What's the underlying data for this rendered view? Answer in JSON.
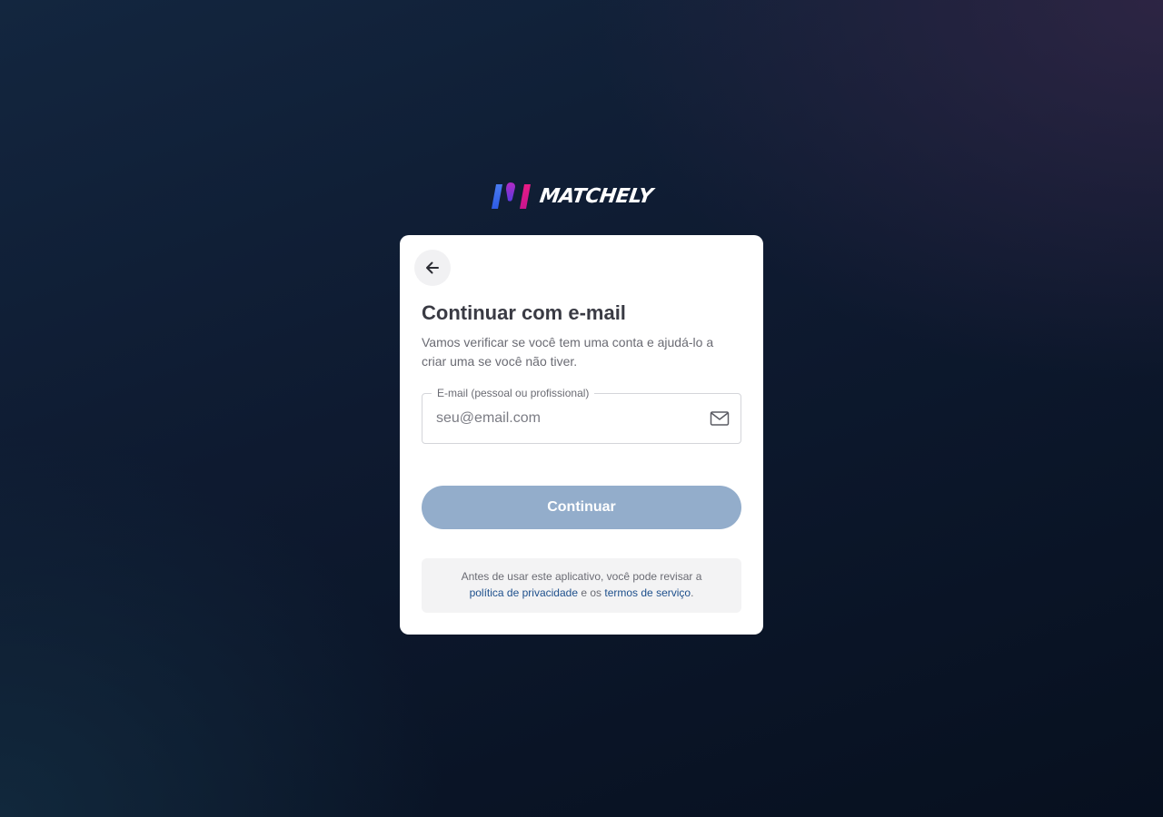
{
  "brand": {
    "name": "MATCHELY",
    "colors": {
      "mark_blue": "#2d5be6",
      "mark_purple": "#8a2fd6",
      "mark_pink": "#e0198a"
    }
  },
  "card": {
    "back_icon": "arrow-left-icon",
    "title": "Continuar com e-mail",
    "subtitle": "Vamos verificar se você tem uma conta e ajudá-lo a criar uma se você não tiver.",
    "email_field": {
      "label": "E-mail (pessoal ou profissional)",
      "placeholder": "seu@email.com",
      "value": "",
      "icon": "mail-icon"
    },
    "continue_button": {
      "label": "Continuar",
      "color": "#93adcb",
      "state": "disabled"
    },
    "notice": {
      "text_before": "Antes de usar este aplicativo, você pode revisar a",
      "privacy_link": "política de privacidade",
      "text_middle": "e os",
      "terms_link": "termos de serviço",
      "text_after": "."
    }
  }
}
